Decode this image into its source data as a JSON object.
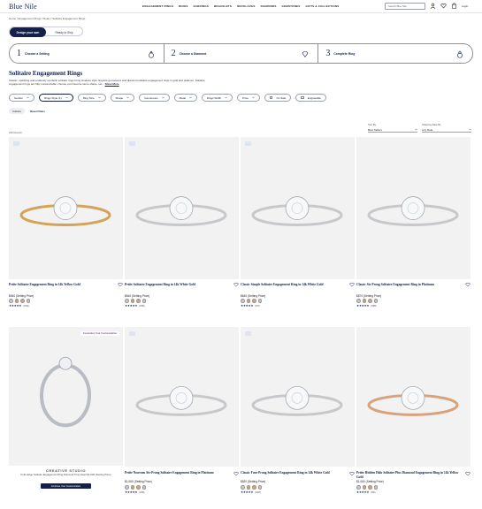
{
  "header": {
    "logo": "Blue Nile",
    "nav": [
      "ENGAGEMENT RINGS",
      "RINGS",
      "EARRINGS",
      "BRACELETS",
      "NECKLACES",
      "DIAMONDS",
      "GEMSTONES",
      "GIFTS & COLLECTIONS"
    ],
    "search_placeholder": "Search Blue Nile",
    "login": "Login"
  },
  "breadcrumb": "Home / Engagement Rings / Styles / Solitaire Engagement Rings",
  "tabs": {
    "active": "Design your own",
    "inactive": "Ready to Ship"
  },
  "steps": [
    {
      "num": "1",
      "label": "Choose a Setting"
    },
    {
      "num": "2",
      "label": "Choose a Diamond"
    },
    {
      "num": "3",
      "label": "Complete Ring"
    }
  ],
  "page": {
    "title": "Solitaire Engagement Rings",
    "description": "Classic, sparkling and endlessly symbolic solitaire rings bring timeless style. Explore gemstones and diamond solitaire engagement rings in gold and platinum. Solitaire engagement rings are fully customizable: choose your favorite stone shape, set...",
    "show_more": "Show More"
  },
  "filters": [
    "Gender",
    "Rings Style (1)",
    "Ring Size",
    "Shape",
    "Gemstones",
    "Metal",
    "Rings Width",
    "Price"
  ],
  "toggles": [
    "On Sale",
    "Engravable"
  ],
  "applied": {
    "pill": "Solitaire",
    "reset": "Reset Filters"
  },
  "sort": {
    "label": "Sort By",
    "value": "Best Sellers"
  },
  "ship": {
    "label": "Shipping Date By",
    "value": "Any Date"
  },
  "results_count": "236 Results",
  "products": [
    {
      "name": "Petite Solitaire Engagement Ring in 14k Yellow Gold",
      "price": "$540 (Setting Price)",
      "reviews": "(1549)",
      "metal": "yellow"
    },
    {
      "name": "Petite Solitaire Engagement Ring in 14k White Gold",
      "price": "$540 (Setting Price)",
      "reviews": "(1055)",
      "metal": "white"
    },
    {
      "name": "Classic Simple Solitaire Engagement Ring in 14k White Gold",
      "price": "$640 (Setting Price)",
      "reviews": "(375)",
      "metal": "white"
    },
    {
      "name": "Classic Six Prong Solitaire Engagement Ring in Platinum",
      "price": "$870 (Setting Price)",
      "reviews": "(1885)",
      "metal": "white"
    },
    {
      "name": "",
      "price": "",
      "reviews": "",
      "metal": "white"
    },
    {
      "name": "Petite Nouveau Six-Prong Solitaire Engagement Ring in Platinum",
      "price": "$1,060 (Setting Price)",
      "reviews": "(1189)",
      "metal": "white"
    },
    {
      "name": "Classic Four Prong Solitaire Engagement Ring in 14k White Gold",
      "price": "$820 (Setting Price)",
      "reviews": "(1308)",
      "metal": "white"
    },
    {
      "name": "Petite Hidden Halo Solitaire Plus Diamond Engagement Ring in 14k Yellow Gold",
      "price": "$1,060 (Setting Price)",
      "reviews": "(390)",
      "metal": "rose"
    }
  ],
  "creative_studio": {
    "badge": "Customize Your Customization",
    "title": "CREATIVE STUDIO",
    "subtitle": "Knife Edge Solitaire Engagement Ring Diamond Trinp Heart $1,600 (Setting Price)",
    "button": "Continue Your Customization"
  },
  "colors": {
    "navy": "#13204a",
    "yellow_gold": "#d4a35a",
    "rose_gold": "#d9a27a",
    "white_gold": "#c8c8cc"
  }
}
